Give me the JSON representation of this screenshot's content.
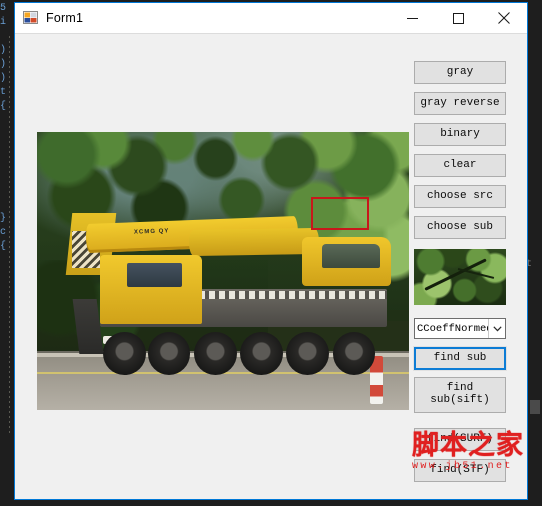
{
  "window": {
    "title": "Form1",
    "icon": "visual-studio-form-icon",
    "controls": {
      "minimize": "minimize-icon",
      "maximize": "maximize-icon",
      "close": "close-icon"
    }
  },
  "buttons": [
    {
      "id": "gray",
      "label": "gray"
    },
    {
      "id": "gray-reverse",
      "label": "gray reverse"
    },
    {
      "id": "binary",
      "label": "binary"
    },
    {
      "id": "clear",
      "label": "clear"
    },
    {
      "id": "choose-src",
      "label": "choose src"
    },
    {
      "id": "choose-sub",
      "label": "choose sub"
    },
    {
      "id": "find-sub",
      "label": "find sub"
    },
    {
      "id": "find-sub-sift",
      "label": "find\nsub(sift)"
    },
    {
      "id": "find-surf",
      "label": "find(SURF)"
    },
    {
      "id": "find-stf",
      "label": "find(STF)"
    }
  ],
  "combo": {
    "value": "CCoeffNormed",
    "arrow": "chevron-down-icon"
  },
  "images": {
    "source": {
      "description": "yellow XCMG mobile crane truck parked on roadside with green foliage behind",
      "roi_label": "matched-region-rectangle",
      "roi_color": "#c8171b"
    },
    "template": {
      "description": "cropped green leaves with dark branch"
    }
  },
  "watermark": {
    "text_cn": "脚本之家",
    "url": "www.jb51.net",
    "color": "#e02020"
  },
  "colors": {
    "form_border": "#0078d7",
    "form_background": "#f0f0f0",
    "button_face": "#e1e1e1",
    "focus_border": "#0c7cd5",
    "editor_background": "#1e1e1e"
  }
}
